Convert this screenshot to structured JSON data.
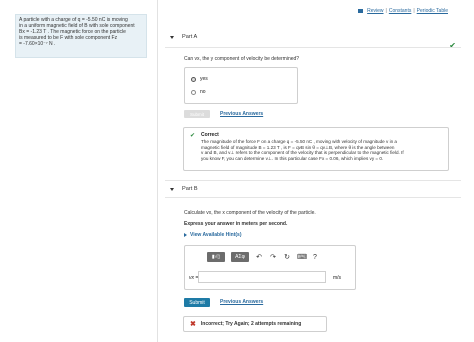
{
  "top_links": {
    "review": "Review",
    "constants": "Constants",
    "periodic_table": "Periodic Table",
    "sep": "|"
  },
  "problem_statement": [
    "A particle with a charge of q = -5.50 nC is moving",
    "in a uniform magnetic field of B with sole component",
    "Bx = -1.23 T . The magnetic force on the particle",
    "is measured to be F with sole component Fz",
    "= -7.60×10⁻⁷ N ."
  ],
  "part_a": {
    "label": "Part A",
    "question": "Can vx, the y component of velocity be determined?",
    "options": [
      "yes",
      "no"
    ],
    "selected": "yes",
    "submit_label": "Submit",
    "previous_answers": "Previous Answers",
    "correct_title": "Correct",
    "correct_body": [
      "The magnitude of the force F on a charge q = -5.50 nC , moving with velocity of magnitude v in a",
      "magnetic field of magnitude B = 1.23 T , is F = qvB sin θ = qv⊥B, where θ is the angle between",
      "v and B, and v⊥ refers to the component of the velocity that is perpendicular to the magnetic field. If",
      "you know F, you can determine v⊥. In this particular case Fx = 0.06, which implies vy = 0."
    ]
  },
  "part_b": {
    "label": "Part B",
    "question": "Calculate vx, the x component of the velocity of the particle.",
    "instruction": "Express your answer in meters per second.",
    "hint_label": "View Available Hint(s)",
    "toolbar": {
      "templates": "▮√▯",
      "greek": "ΑΣφ",
      "undo": "↶",
      "redo": "↷",
      "reset": "↻",
      "keyboard": "⌨",
      "help": "?"
    },
    "answer_label": "vx =",
    "answer_value": "",
    "unit": "m/s",
    "submit_label": "Submit",
    "previous_answers": "Previous Answers",
    "feedback": "Incorrect; Try Again; 2 attempts remaining"
  }
}
